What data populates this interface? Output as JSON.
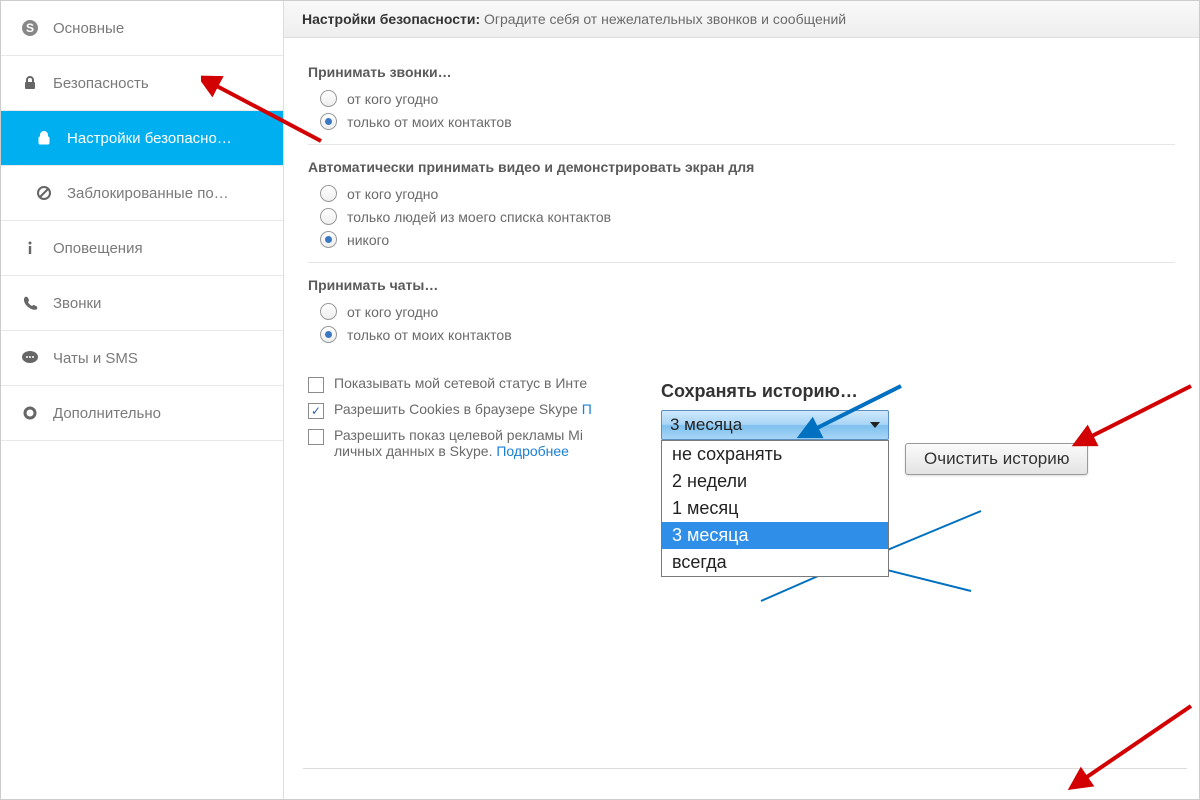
{
  "sidebar": {
    "items": [
      {
        "label": "Основные"
      },
      {
        "label": "Безопасность"
      },
      {
        "label": "Настройки безопасно…"
      },
      {
        "label": "Заблокированные по…"
      },
      {
        "label": "Оповещения"
      },
      {
        "label": "Звонки"
      },
      {
        "label": "Чаты и SMS"
      },
      {
        "label": "Дополнительно"
      }
    ]
  },
  "header": {
    "title": "Настройки безопасности:",
    "subtitle": "Оградите себя от нежелательных звонков и сообщений"
  },
  "sections": {
    "calls": {
      "title": "Принимать звонки…",
      "opt_anyone": "от кого угодно",
      "opt_contacts": "только от моих контактов"
    },
    "video": {
      "title": "Автоматически принимать видео и демонстрировать экран для",
      "opt_anyone": "от кого угодно",
      "opt_contacts": "только людей из моего списка контактов",
      "opt_nobody": "никого"
    },
    "chats": {
      "title": "Принимать чаты…",
      "opt_anyone": "от кого угодно",
      "opt_contacts": "только от моих контактов"
    }
  },
  "checks": {
    "status": "Показывать мой сетевой статус в Инте",
    "cookies": "Разрешить Cookies в браузере Skype",
    "cookies_link": "П",
    "ads": "Разрешить показ целевой рекламы Mi",
    "ads2": "личных данных в Skype.",
    "ads_link": "Подробнее"
  },
  "history": {
    "title": "Сохранять историю…",
    "selected": "3 месяца",
    "options": [
      "не сохранять",
      "2 недели",
      "1 месяц",
      "3 месяца",
      "всегда"
    ],
    "clear": "Очистить историю"
  }
}
